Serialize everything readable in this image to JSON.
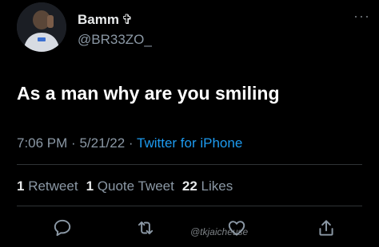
{
  "user": {
    "display_name": "Bamm",
    "name_symbol": "✞",
    "handle": "@BR33ZO_"
  },
  "more_icon_label": "···",
  "tweet": {
    "text": "As a man why are you smiling",
    "time": "7:06 PM",
    "date": "5/21/22",
    "separator": "·",
    "source": "Twitter for iPhone"
  },
  "stats": {
    "retweets_count": "1",
    "retweets_label": "Retweet",
    "quotes_count": "1",
    "quotes_label": "Quote Tweet",
    "likes_count": "22",
    "likes_label": "Likes"
  },
  "actions": {
    "icons": [
      "reply-icon",
      "retweet-icon",
      "like-icon",
      "share-icon"
    ]
  },
  "watermark": "@tkjaicheuse",
  "colors": {
    "background": "#000000",
    "text_primary": "#e7e9ea",
    "text_secondary": "#8b98a5",
    "link": "#1d9bf0",
    "divider": "#2f3336"
  }
}
